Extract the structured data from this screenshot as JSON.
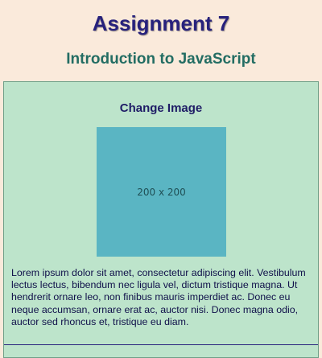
{
  "header": {
    "title": "Assignment 7",
    "subtitle": "Introduction to JavaScript"
  },
  "panel": {
    "heading": "Change Image",
    "image": {
      "placeholder_label": "200 x 200"
    },
    "paragraph": "Lorem ipsum dolor sit amet, consectetur adipiscing elit. Vestibulum lectus lectus, bibendum nec ligula vel, dictum tristique magna. Ut hendrerit ornare leo, non finibus mauris imperdiet ac. Donec eu neque accumsan, ornare erat ac, auctor nisi. Donec magna odio, auctor sed rhoncus et, tristique eu diam."
  },
  "colors": {
    "page_background": "#faeadb",
    "title": "#27217c",
    "subtitle": "#236d63",
    "panel_background": "#bde4cb",
    "image_placeholder": "#5ab5c3"
  }
}
